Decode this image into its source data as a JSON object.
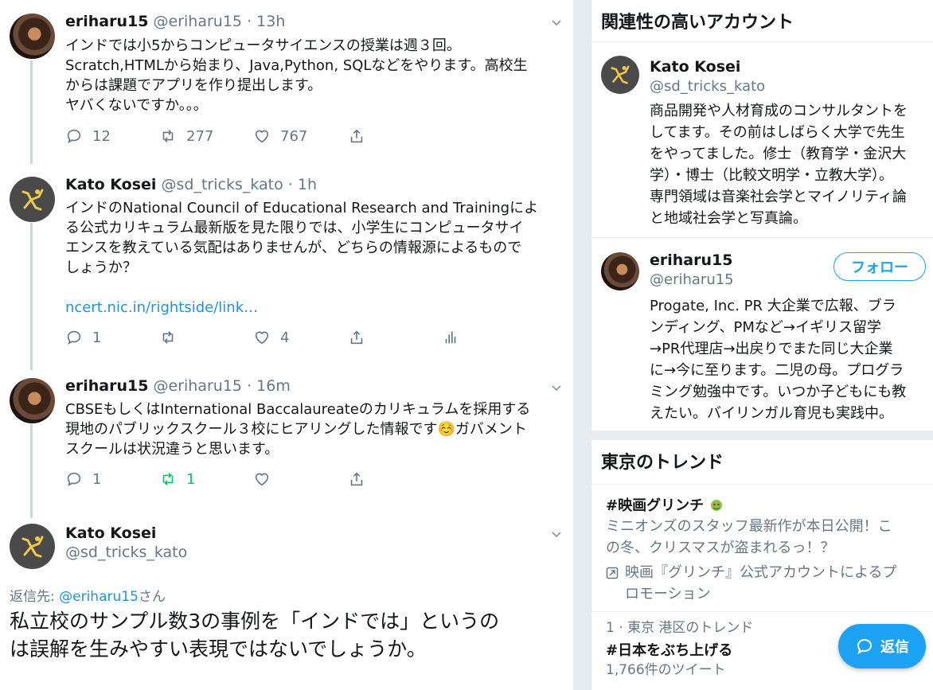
{
  "tweets": [
    {
      "name": "eriharu15",
      "handle": "@eriharu15",
      "time": "· 13h",
      "lines": [
        "インドでは小5からコンピュータサイエンスの授業は週３回。",
        "Scratch,HTMLから始まり、Java,Python, SQLなどをやります。高校生",
        "からは課題でアプリを作り提出します。",
        "ヤバくないですか。。。"
      ],
      "replies": "12",
      "retweets": "277",
      "likes": "767"
    },
    {
      "name": "Kato Kosei",
      "handle": "@sd_tricks_kato",
      "time": "· 1h",
      "lines": [
        "インドのNational Council of Educational Research and Trainingによ",
        "る公式カリキュラム最新版を見た限りでは、小学生にコンピュータサイ",
        "エンスを教えている気配はありませんが、どちらの情報源によるもので",
        "しょうか？"
      ],
      "link": "ncert.nic.in/rightside/link…",
      "replies": "1",
      "retweets": "",
      "likes": "4"
    },
    {
      "name": "eriharu15",
      "handle": "@eriharu15",
      "time": "· 16m",
      "lines": [
        "CBSEもしくはInternational Baccalaureateのカリキュラムを採用する",
        "現地のパブリックスクール３校にヒアリングした情報です☺️ガバメント",
        "スクールは状況違うと思います。"
      ],
      "replies": "1",
      "retweets": "1",
      "likes": ""
    }
  ],
  "main_tweet": {
    "name": "Kato Kosei",
    "handle": "@sd_tricks_kato",
    "reply_to_prefix": "返信先: ",
    "reply_to_handle": "@eriharu15",
    "reply_to_suffix": "さん",
    "lines": [
      "私立校のサンプル数3の事例を「インドでは」というの",
      "は誤解を生みやすい表現ではないでしょうか。"
    ]
  },
  "sidebar": {
    "related_title": "関連性の高いアカウント",
    "accounts": [
      {
        "name": "Kato Kosei",
        "handle": "@sd_tricks_kato",
        "bio": [
          "商品開発や人材育成のコンサルタントを",
          "してます。その前はしばらく大学で先生",
          "をやってました。修士（教育学・金沢大",
          "学）・博士（比較文明学・立教大学）。",
          "専門領域は音楽社会学とマイノリティ論",
          "と地域社会学と写真論。"
        ]
      },
      {
        "name": "eriharu15",
        "handle": "@eriharu15",
        "follow_label": "フォロー",
        "bio": [
          "Progate, Inc. PR 大企業で広報、ブラ",
          "ンディング、PMなど→イギリス留学",
          "→PR代理店→出戻りでまた同じ大企業",
          "に→今に至ります。二児の母。プログラ",
          "ミング勉強中です。いつか子どもにも教",
          "えたい。バイリンガル育児も実践中。"
        ]
      }
    ],
    "trends_title": "東京のトレンド",
    "trends": [
      {
        "tag": "#映画グリンチ",
        "desc": [
          "ミニオンズのスタッフ最新作が本日公開！こ",
          "の冬、クリスマスが盗まれるっ！？"
        ],
        "promo": [
          "映画『グリンチ』公式アカウントによるプ",
          "ロモーション"
        ]
      },
      {
        "context": "1 · 東京 港区のトレンド",
        "tag": "#日本をぶち上げる",
        "count": "1,766件のツイート"
      }
    ]
  },
  "reply_button_label": "返信",
  "colors": {
    "accent": "#1da1f2",
    "retweet_green": "#17bf63",
    "secondary_text": "#657786"
  }
}
